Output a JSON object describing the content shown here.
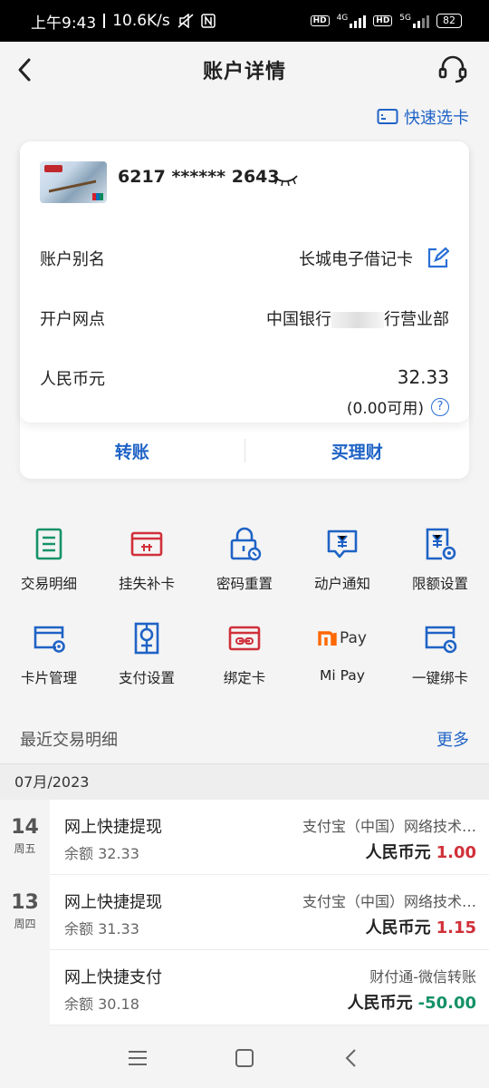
{
  "status_bar": {
    "time": "上午9:43",
    "speed": "10.6K/s",
    "battery": "82",
    "net1": "4G",
    "net2": "5G",
    "hd": "HD"
  },
  "header": {
    "title": "账户详情"
  },
  "quick_select": {
    "label": "快速选卡"
  },
  "card": {
    "number": "6217 ****** 2643",
    "alias_label": "账户别名",
    "alias_value": "长城电子借记卡",
    "branch_label": "开户网点",
    "branch_prefix": "中国银行",
    "branch_suffix": "行营业部",
    "currency_label": "人民币元",
    "balance": "32.33",
    "available": "(0.00可用)",
    "help_mark": "?"
  },
  "card_actions": {
    "transfer": "转账",
    "buy_finance": "买理财"
  },
  "services": [
    {
      "label": "交易明细",
      "icon": "transaction-detail-icon"
    },
    {
      "label": "挂失补卡",
      "icon": "report-loss-icon"
    },
    {
      "label": "密码重置",
      "icon": "password-reset-icon"
    },
    {
      "label": "动户通知",
      "icon": "account-notice-icon"
    },
    {
      "label": "限额设置",
      "icon": "limit-setting-icon"
    },
    {
      "label": "卡片管理",
      "icon": "card-manage-icon"
    },
    {
      "label": "支付设置",
      "icon": "payment-setting-icon"
    },
    {
      "label": "绑定卡",
      "icon": "bind-card-icon"
    },
    {
      "label": "Mi Pay",
      "icon": "mipay-icon",
      "logo_text": "Pay"
    },
    {
      "label": "一键绑卡",
      "icon": "one-click-bind-icon"
    }
  ],
  "recent": {
    "title": "最近交易明细",
    "more": "更多",
    "month": "07月/2023"
  },
  "days": [
    {
      "day": "14",
      "weekday": "周五"
    },
    {
      "day": "13",
      "weekday": "周四"
    }
  ],
  "transactions": [
    {
      "name": "网上快捷提现",
      "balance": "余额 32.33",
      "party": "支付宝（中国）网络技术…",
      "currency": "人民币元",
      "amount": "1.00",
      "color": "#d0303a"
    },
    {
      "name": "网上快捷提现",
      "balance": "余额 31.33",
      "party": "支付宝（中国）网络技术…",
      "currency": "人民币元",
      "amount": "1.15",
      "color": "#d0303a"
    },
    {
      "name": "网上快捷支付",
      "balance": "余额 30.18",
      "party": "财付通-微信转账",
      "currency": "人民币元",
      "amount": "-50.00",
      "color": "#149266"
    }
  ],
  "colors": {
    "accent": "#1f63c6",
    "income": "#d0303a",
    "expense": "#149266"
  }
}
